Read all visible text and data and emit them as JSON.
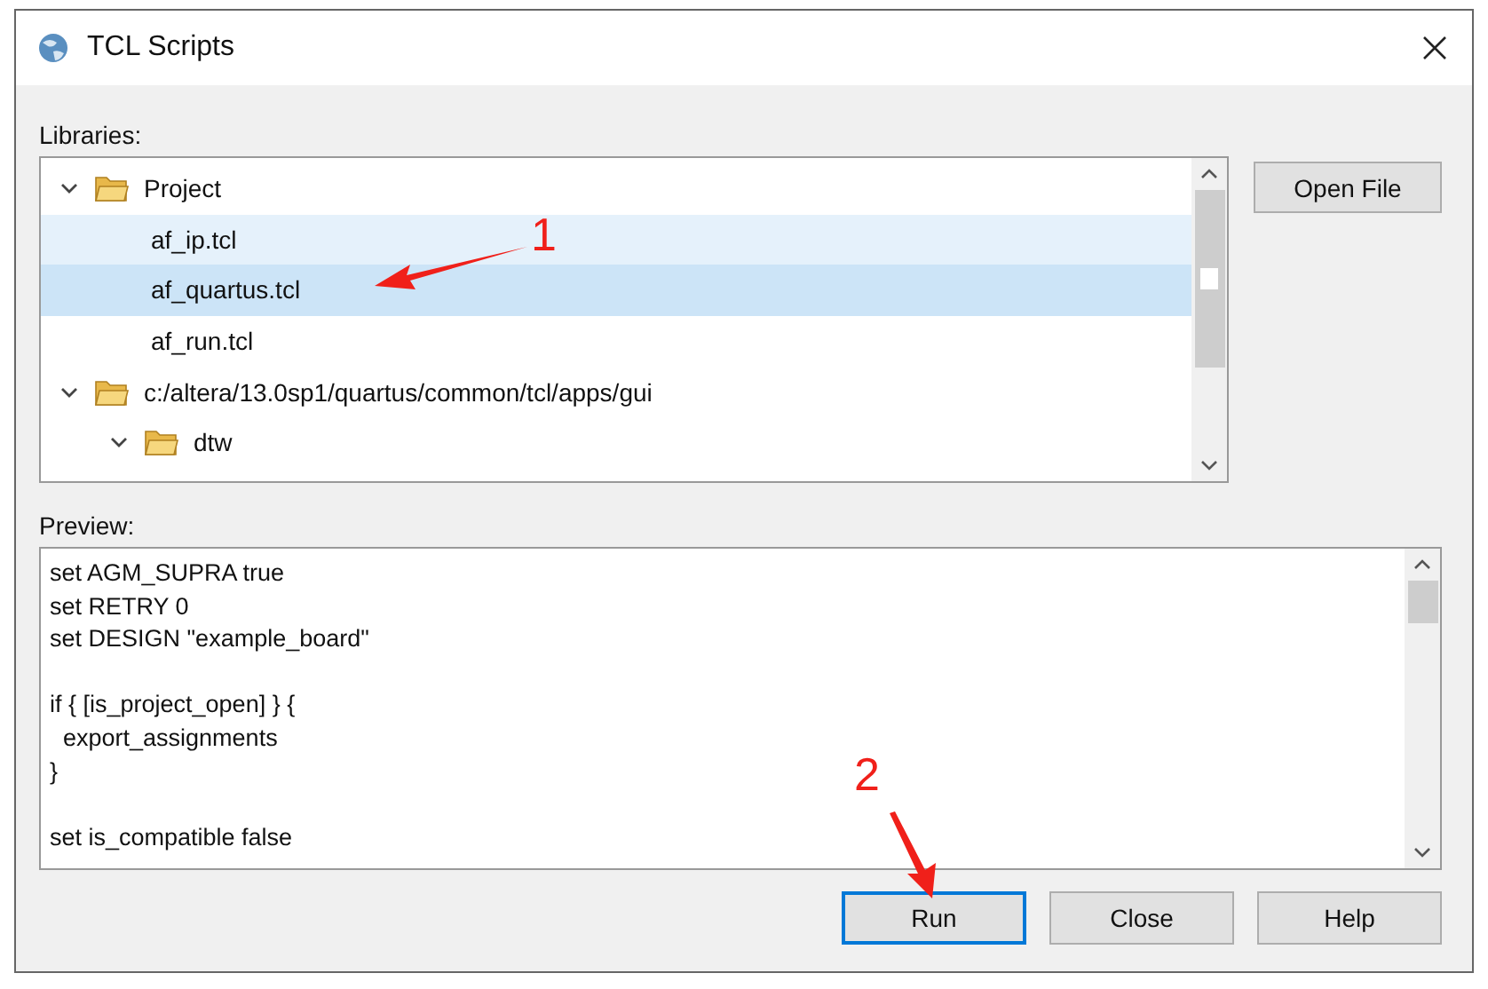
{
  "window": {
    "title": "TCL Scripts"
  },
  "libraries": {
    "label": "Libraries:",
    "tree": [
      {
        "label": "Project",
        "kind": "folder",
        "expanded": true,
        "children": [
          {
            "label": "af_ip.tcl",
            "kind": "file",
            "selected": false,
            "hovered": true
          },
          {
            "label": "af_quartus.tcl",
            "kind": "file",
            "selected": true,
            "hovered": false
          },
          {
            "label": "af_run.tcl",
            "kind": "file",
            "selected": false,
            "hovered": false
          }
        ]
      },
      {
        "label": "c:/altera/13.0sp1/quartus/common/tcl/apps/gui",
        "kind": "folder",
        "expanded": true,
        "children": [
          {
            "label": "dtw",
            "kind": "folder",
            "expanded": true
          }
        ]
      }
    ]
  },
  "side_buttons": [
    "Open File"
  ],
  "preview": {
    "label": "Preview:",
    "blocks": [
      [
        "set AGM_SUPRA true",
        "set RETRY 0",
        "set DESIGN \"example_board\""
      ],
      [
        "if { [is_project_open] } {",
        "  export_assignments",
        "}"
      ],
      [
        "set is_compatible false"
      ]
    ]
  },
  "buttons": [
    {
      "label": "Run",
      "focused": true
    },
    {
      "label": "Close",
      "focused": false
    },
    {
      "label": "Help",
      "focused": false
    }
  ],
  "annotations": [
    {
      "label": "1",
      "kind": "left"
    },
    {
      "label": "2",
      "kind": "down"
    }
  ]
}
